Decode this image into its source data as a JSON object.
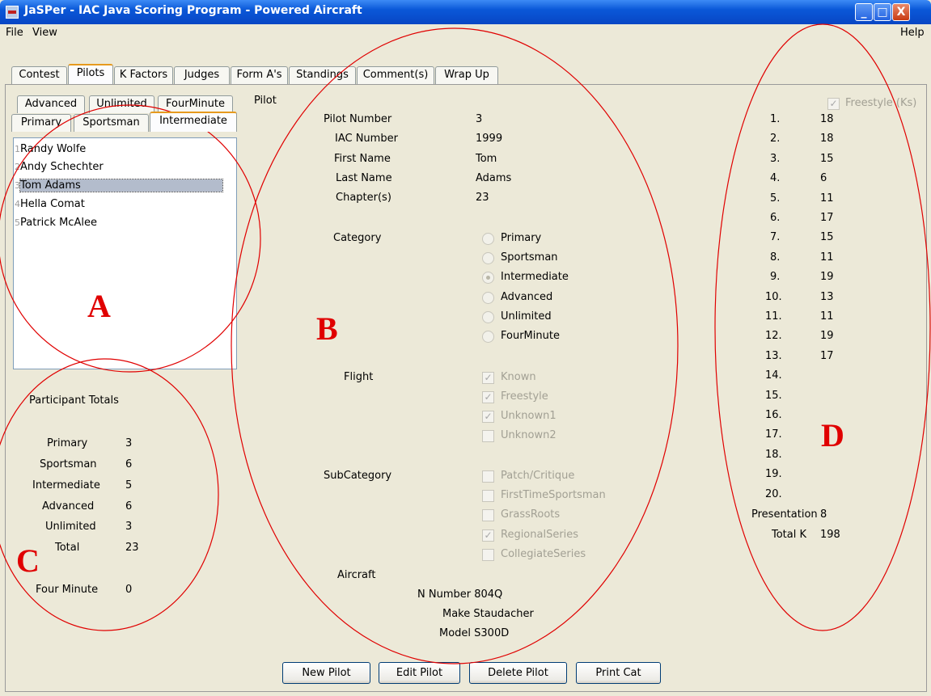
{
  "window": {
    "title": "JaSPer - IAC Java Scoring Program - Powered Aircraft",
    "min": "_",
    "max": "□",
    "close": "X"
  },
  "menu": {
    "file": "File",
    "view": "View",
    "help": "Help"
  },
  "tabs": [
    "Contest",
    "Pilots",
    "K Factors",
    "Judges",
    "Form A's",
    "Standings",
    "Comment(s)",
    "Wrap Up"
  ],
  "category_tabs_row1": [
    "Advanced",
    "Unlimited",
    "FourMinute"
  ],
  "category_tabs_row2": [
    "Primary",
    "Sportsman",
    "Intermediate"
  ],
  "pilot_list": [
    {
      "num": "1",
      "name": "Randy Wolfe"
    },
    {
      "num": "2",
      "name": "Andy Schechter"
    },
    {
      "num": "3",
      "name": "Tom Adams"
    },
    {
      "num": "4",
      "name": "Hella Comat"
    },
    {
      "num": "5",
      "name": "Patrick McAlee"
    }
  ],
  "participant_totals": {
    "title": "Participant Totals",
    "rows": [
      {
        "label": "Primary",
        "value": "3"
      },
      {
        "label": "Sportsman",
        "value": "6"
      },
      {
        "label": "Intermediate",
        "value": "5"
      },
      {
        "label": "Advanced",
        "value": "6"
      },
      {
        "label": "Unlimited",
        "value": "3"
      },
      {
        "label": "Total",
        "value": "23"
      }
    ],
    "four_minute_label": "Four Minute",
    "four_minute_value": "0"
  },
  "pilot": {
    "section_label": "Pilot",
    "fields": [
      {
        "label": "Pilot Number",
        "value": "3"
      },
      {
        "label": "IAC Number",
        "value": "1999"
      },
      {
        "label": "First Name",
        "value": "Tom"
      },
      {
        "label": "Last Name",
        "value": "Adams"
      },
      {
        "label": "Chapter(s)",
        "value": "23"
      }
    ],
    "category_label": "Category",
    "categories": [
      "Primary",
      "Sportsman",
      "Intermediate",
      "Advanced",
      "Unlimited",
      "FourMinute"
    ],
    "selected_category": "Intermediate",
    "flight_label": "Flight",
    "flights": [
      {
        "label": "Known",
        "checked": true
      },
      {
        "label": "Freestyle",
        "checked": true
      },
      {
        "label": "Unknown1",
        "checked": true
      },
      {
        "label": "Unknown2",
        "checked": false
      }
    ],
    "subcategory_label": "SubCategory",
    "subcategories": [
      {
        "label": "Patch/Critique",
        "checked": false
      },
      {
        "label": "FirstTimeSportsman",
        "checked": false
      },
      {
        "label": "GrassRoots",
        "checked": false
      },
      {
        "label": "RegionalSeries",
        "checked": true
      },
      {
        "label": "CollegiateSeries",
        "checked": false
      }
    ],
    "aircraft_label": "Aircraft",
    "n_number": "N Number 804Q",
    "make": "Make Staudacher",
    "model": "Model S300D"
  },
  "kfactors": {
    "freestyle_label": "Freestyle (Ks)",
    "freestyle_checked": true,
    "rows": [
      {
        "n": "1.",
        "k": "18"
      },
      {
        "n": "2.",
        "k": "18"
      },
      {
        "n": "3.",
        "k": "15"
      },
      {
        "n": "4.",
        "k": "6"
      },
      {
        "n": "5.",
        "k": "11"
      },
      {
        "n": "6.",
        "k": "17"
      },
      {
        "n": "7.",
        "k": "15"
      },
      {
        "n": "8.",
        "k": "11"
      },
      {
        "n": "9.",
        "k": "19"
      },
      {
        "n": "10.",
        "k": "13"
      },
      {
        "n": "11.",
        "k": "11"
      },
      {
        "n": "12.",
        "k": "19"
      },
      {
        "n": "13.",
        "k": "17"
      },
      {
        "n": "14.",
        "k": ""
      },
      {
        "n": "15.",
        "k": ""
      },
      {
        "n": "16.",
        "k": ""
      },
      {
        "n": "17.",
        "k": ""
      },
      {
        "n": "18.",
        "k": ""
      },
      {
        "n": "19.",
        "k": ""
      },
      {
        "n": "20.",
        "k": ""
      }
    ],
    "presentation_label": "Presentation",
    "presentation_value": "8",
    "total_label": "Total K",
    "total_value": "198"
  },
  "buttons": {
    "new": "New Pilot",
    "edit": "Edit Pilot",
    "delete": "Delete Pilot",
    "print": "Print Cat"
  },
  "annotations": [
    "A",
    "B",
    "C",
    "D"
  ],
  "annotation_color": "#e00000"
}
